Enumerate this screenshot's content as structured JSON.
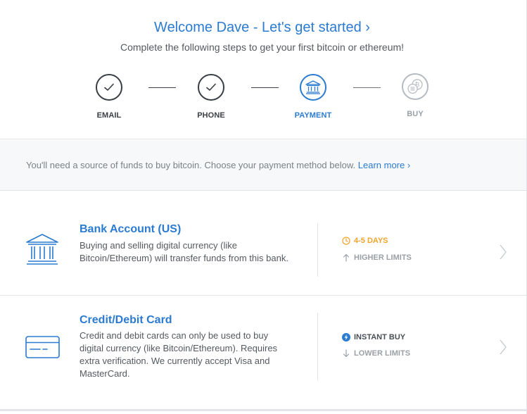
{
  "header": {
    "title": "Welcome Dave - Let's get started ›",
    "subtitle": "Complete the following steps to get your first bitcoin or ethereum!"
  },
  "steps": [
    {
      "label": "EMAIL",
      "state": "done",
      "icon": "checkmark-icon"
    },
    {
      "label": "PHONE",
      "state": "done",
      "icon": "checkmark-icon"
    },
    {
      "label": "PAYMENT",
      "state": "active",
      "icon": "bank-icon"
    },
    {
      "label": "BUY",
      "state": "pending",
      "icon": "coins-icon"
    }
  ],
  "info": {
    "text": "You'll need a source of funds to buy bitcoin. Choose your payment method below.",
    "link": "Learn more ›"
  },
  "payment_methods": [
    {
      "title": "Bank Account (US)",
      "description": "Buying and selling digital currency (like Bitcoin/Ethereum) will transfer funds from this bank.",
      "icon": "bank-icon",
      "features": [
        {
          "text": "4-5 DAYS",
          "icon": "clock-icon"
        },
        {
          "text": "HIGHER LIMITS",
          "icon": "arrow-up-icon"
        }
      ]
    },
    {
      "title": "Credit/Debit Card",
      "description": "Credit and debit cards can only be used to buy digital currency (like Bitcoin/Ethereum). Requires extra verification. We currently accept Visa and MasterCard.",
      "icon": "credit-card-icon",
      "features": [
        {
          "text": "INSTANT BUY",
          "icon": "lightning-icon"
        },
        {
          "text": "LOWER LIMITS",
          "icon": "arrow-down-icon"
        }
      ]
    }
  ],
  "colors": {
    "accent": "#2a7bd1",
    "warning": "#f0a32b",
    "muted": "#9aa0a6",
    "text": "#4a4f55",
    "band": "#f7f8f9"
  }
}
